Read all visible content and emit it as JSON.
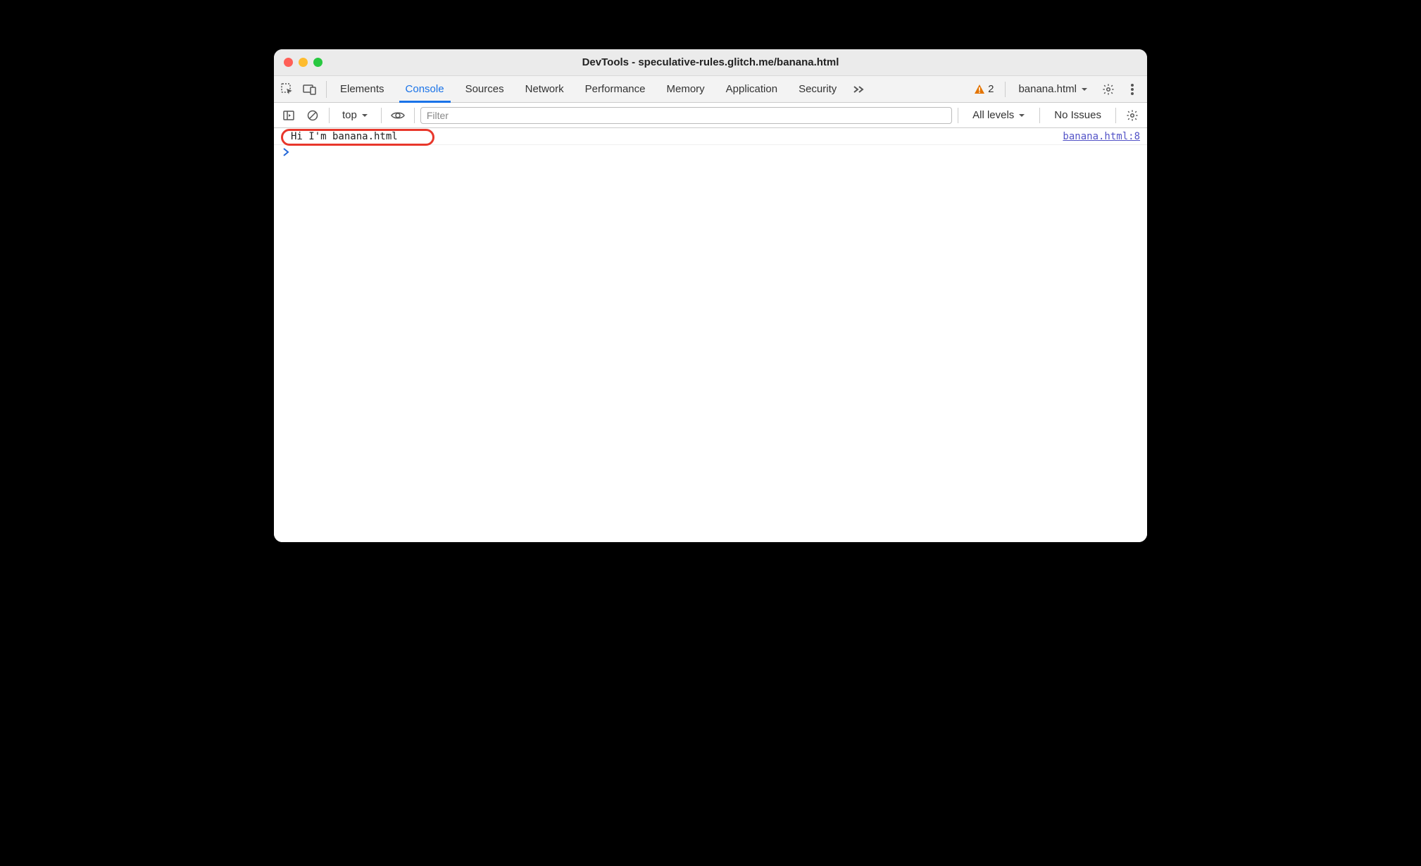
{
  "window": {
    "title": "DevTools - speculative-rules.glitch.me/banana.html"
  },
  "tabs": {
    "items": [
      "Elements",
      "Console",
      "Sources",
      "Network",
      "Performance",
      "Memory",
      "Application",
      "Security"
    ],
    "active_index": 1
  },
  "status": {
    "warnings_count": "2",
    "target_label": "banana.html"
  },
  "toolbar": {
    "context_label": "top",
    "filter_placeholder": "Filter",
    "levels_label": "All levels",
    "issues_label": "No Issues"
  },
  "console": {
    "logs": [
      {
        "message": "Hi I'm banana.html",
        "source": "banana.html:8"
      }
    ]
  }
}
